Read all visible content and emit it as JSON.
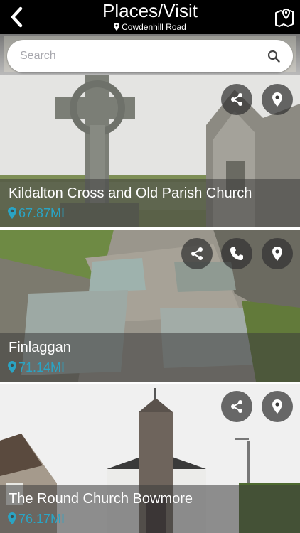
{
  "header": {
    "title": "Places/Visit",
    "subtitle": "Cowdenhill Road"
  },
  "search": {
    "placeholder": "Search"
  },
  "places": [
    {
      "title": "Kildalton Cross and Old Parish Church",
      "distance": "67.87MI"
    },
    {
      "title": "Finlaggan",
      "distance": "71.14MI"
    },
    {
      "title": "The Round Church Bowmore",
      "distance": "76.17MI"
    }
  ],
  "icons": {
    "back": "chevron-left-icon",
    "map": "map-pin-icon",
    "search": "search-icon",
    "share": "share-icon",
    "phone": "phone-icon",
    "location": "location-pin-icon"
  },
  "colors": {
    "distance": "#2aa4c4",
    "header": "#000000"
  }
}
